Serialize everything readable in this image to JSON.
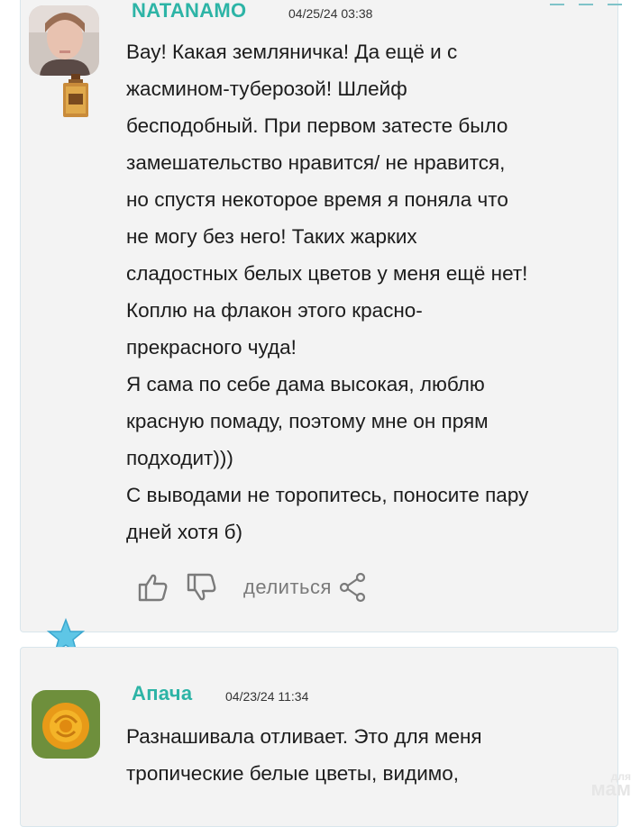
{
  "comments": [
    {
      "username": "NATANAMO",
      "date": "04/25/24 03:38",
      "lines": [
        "Вау! Какая земляничка! Да ещё и с",
        "жасмином-туберозой! Шлейф",
        "бесподобный. При первом затесте было",
        "замешательство нравится/ не нравится,",
        "но спустя некоторое время я поняла что",
        "не могу без него! Таких жарких",
        "сладостных белых цветов у меня ещё нет!",
        "Коплю на флакон этого красно-",
        "прекрасного чуда!",
        "Я сама по себе дама высокая, люблю",
        "красную помаду, поэтому мне он прям",
        "подходит)))",
        "С выводами не торопитесь, поносите пару",
        "дней хотя б)"
      ],
      "actions": {
        "share_label": "делиться"
      }
    },
    {
      "username": "Апача",
      "date": "04/23/24 11:34",
      "lines": [
        "Разнашивала отливает. Это для меня",
        "тропические белые цветы, видимо,"
      ]
    }
  ],
  "watermark": {
    "small": "для",
    "big": "мам"
  },
  "icons": [
    "like-icon",
    "dislike-icon",
    "share-icon",
    "star-badge-icon",
    "perfume-badge-icon"
  ],
  "colors": {
    "username": "#2db4a6",
    "card_bg": "#f3f3f3",
    "card_border": "#d9e6ec",
    "action_gray": "#7a7a7a"
  }
}
